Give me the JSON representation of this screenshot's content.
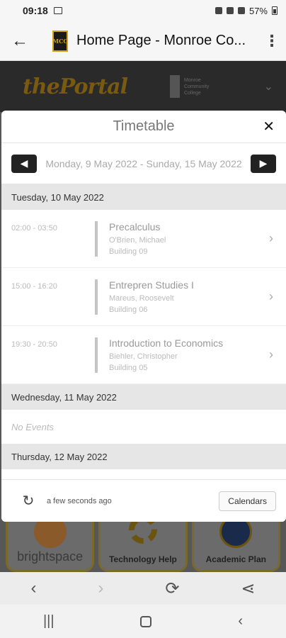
{
  "status_bar": {
    "time": "09:18",
    "battery": "57%"
  },
  "app_bar": {
    "title": "Home Page - Monroe Co...",
    "logo_text": "MCC"
  },
  "portal": {
    "logo_text": "thePortal",
    "college_text": "Monroe Community College"
  },
  "tiles": [
    {
      "label": "brightspace"
    },
    {
      "label": "Technology Help"
    },
    {
      "label": "Academic Plan"
    }
  ],
  "modal": {
    "title": "Timetable",
    "week_range": "Monday, 9 May 2022 - Sunday, 15 May 2022",
    "days": [
      {
        "header": "Tuesday, 10 May 2022",
        "events": [
          {
            "time": "02:00 - 03:50",
            "title": "Precalculus",
            "instructor": "O'Brien, Michael",
            "location": "Building 09"
          },
          {
            "time": "15:00 - 16:20",
            "title": "Entrepren Studies I",
            "instructor": "Mareus, Roosevelt",
            "location": "Building 06"
          },
          {
            "time": "19:30 - 20:50",
            "title": "Introduction to Economics",
            "instructor": "Biehler, Christopher",
            "location": "Building 05"
          }
        ]
      },
      {
        "header": "Wednesday, 11 May 2022",
        "no_events": "No Events"
      },
      {
        "header": "Thursday, 12 May 2022"
      }
    ],
    "footer": {
      "refresh_text": "a few seconds ago",
      "calendars_label": "Calendars"
    }
  },
  "colors": {
    "accent_gold": "#d4a017",
    "dim_overlay": "#575757"
  }
}
